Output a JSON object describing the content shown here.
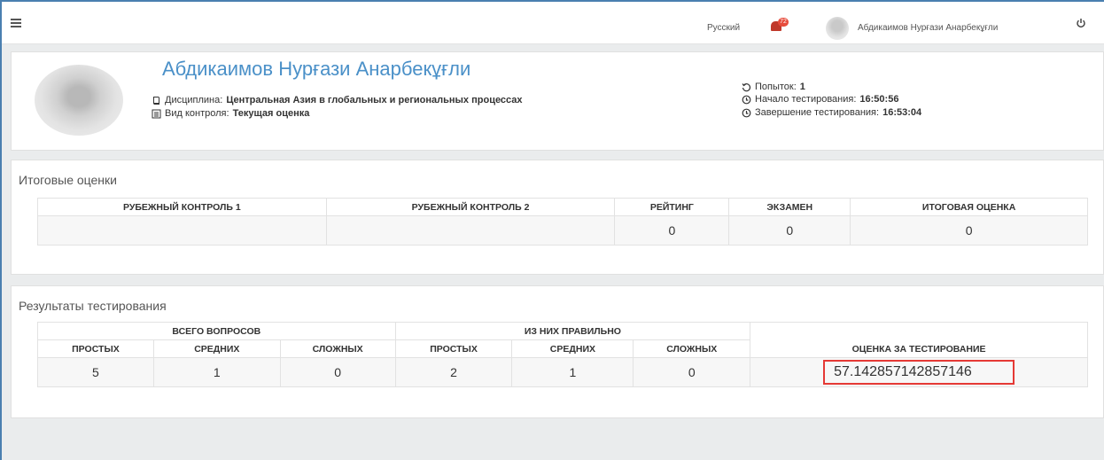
{
  "topbar": {
    "language": "Русский",
    "notification_count": "72",
    "user_name": "Абдикаимов Нурғази Анарбекұғли"
  },
  "profile": {
    "name": "Абдикаимов Нурғази Анарбекұғли",
    "discipline_label": "Дисциплина:",
    "discipline_value": "Центральная Азия в глобальных и региональных процессах",
    "control_label": "Вид контроля:",
    "control_value": "Текущая оценка",
    "attempts_label": "Попыток:",
    "attempts_value": "1",
    "start_label": "Начало тестирования:",
    "start_value": "16:50:56",
    "end_label": "Завершение тестирования:",
    "end_value": "16:53:04"
  },
  "final_grades": {
    "title": "Итоговые оценки",
    "headers": [
      "РУБЕЖНЫЙ КОНТРОЛЬ 1",
      "РУБЕЖНЫЙ КОНТРОЛЬ 2",
      "РЕЙТИНГ",
      "ЭКЗАМЕН",
      "ИТОГОВАЯ ОЦЕНКА"
    ],
    "values": [
      "",
      "",
      "0",
      "0",
      "0"
    ]
  },
  "test_results": {
    "title": "Результаты тестирования",
    "group_total": "ВСЕГО ВОПРОСОВ",
    "group_correct": "ИЗ НИХ ПРАВИЛЬНО",
    "score_header": "ОЦЕНКА ЗА ТЕСТИРОВАНИЕ",
    "sub_headers": [
      "ПРОСТЫХ",
      "СРЕДНИХ",
      "СЛОЖНЫХ",
      "ПРОСТЫХ",
      "СРЕДНИХ",
      "СЛОЖНЫХ"
    ],
    "values": [
      "5",
      "1",
      "0",
      "2",
      "1",
      "0"
    ],
    "score": "57.142857142857146"
  },
  "colors": {
    "accent": "#4a90c8",
    "highlight_border": "#e53935",
    "badge": "#e74c3c"
  }
}
